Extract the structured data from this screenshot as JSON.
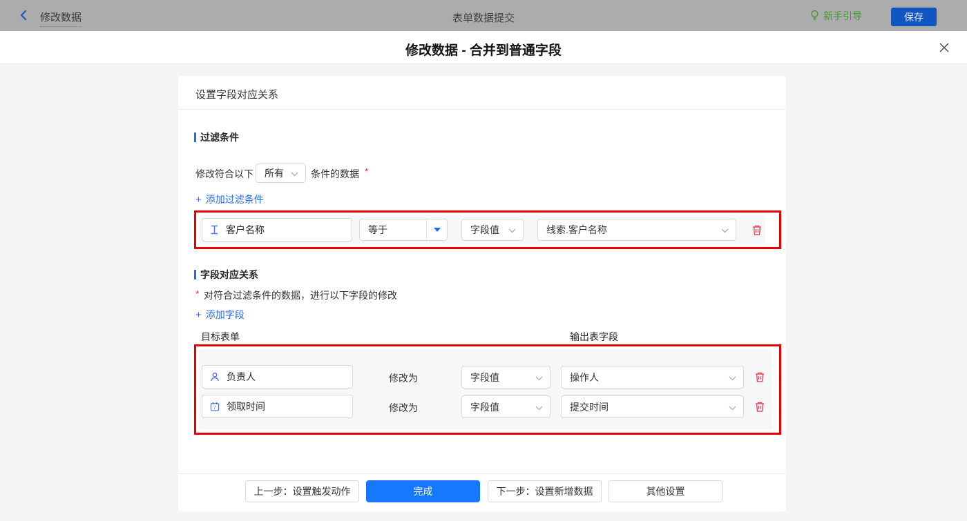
{
  "topbar": {
    "back_label": "修改数据",
    "title": "表单数据提交",
    "guide_label": "新手引导",
    "save_label": "保存"
  },
  "modal": {
    "title": "修改数据 - 合并到普通字段"
  },
  "card": {
    "header": "设置字段对应关系"
  },
  "filter": {
    "section_title": "过滤条件",
    "condition_prefix": "修改符合以下",
    "condition_select": "所有",
    "condition_suffix": "条件的数据",
    "required_mark": "*",
    "add_link_plus": "+",
    "add_link": "添加过滤条件",
    "row": {
      "field": "客户名称",
      "field_icon": "text-field-icon",
      "operator": "等于",
      "value_type": "字段值",
      "value": "线索.客户名称"
    }
  },
  "mapping": {
    "section_title": "字段对应关系",
    "required_mark": "*",
    "note": "对符合过滤条件的数据，进行以下字段的修改",
    "add_link_plus": "+",
    "add_link": "添加字段",
    "col_target": "目标表单",
    "col_output": "输出表字段",
    "rows": [
      {
        "field": "负责人",
        "field_icon": "person-icon",
        "action": "修改为",
        "value_type": "字段值",
        "value": "操作人"
      },
      {
        "field": "领取时间",
        "field_icon": "calendar-icon",
        "action": "修改为",
        "value_type": "字段值",
        "value": "提交时间"
      }
    ]
  },
  "footer": {
    "buttons": [
      {
        "label": "上一步：设置触发动作",
        "type": "default"
      },
      {
        "label": "完成",
        "type": "primary"
      },
      {
        "label": "下一步：设置新增数据",
        "type": "default"
      },
      {
        "label": "其他设置",
        "type": "default"
      }
    ]
  },
  "colors": {
    "accent_blue": "#2468f2",
    "primary_button": "#1677ff",
    "annotation_red": "#e80000",
    "trash_red": "#f4465a",
    "guide_green": "#41982e",
    "topbar_gray": "#acacac"
  }
}
